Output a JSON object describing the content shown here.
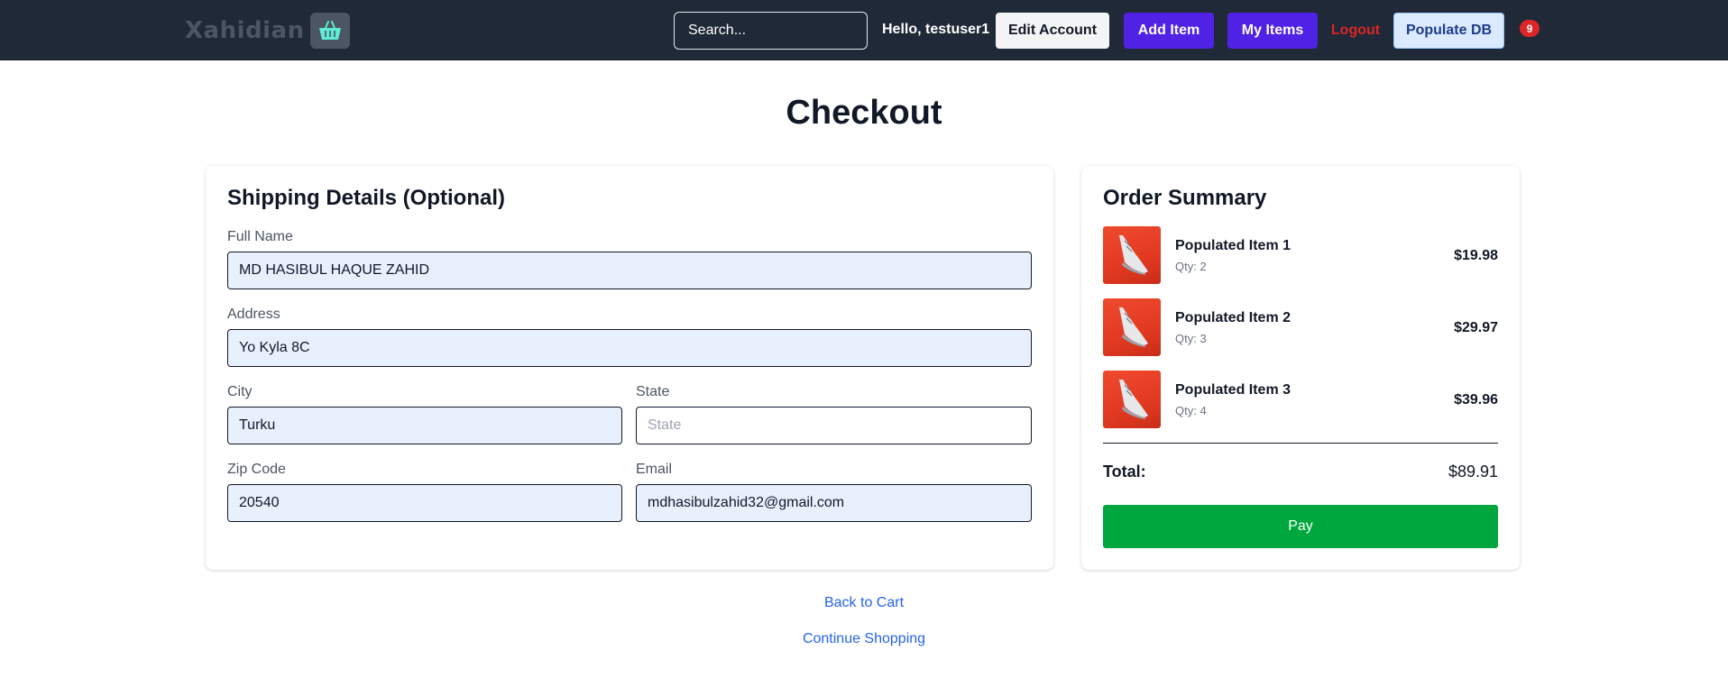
{
  "navbar": {
    "logo_text": "Xahidian",
    "logo_icon": "basket-icon",
    "search_placeholder": "Search...",
    "greeting": "Hello, testuser1",
    "edit_account_label": "Edit Account",
    "add_item_label": "Add Item",
    "my_items_label": "My Items",
    "logout_label": "Logout",
    "populate_db_label": "Populate DB",
    "cart_count": "9"
  },
  "page": {
    "title": "Checkout"
  },
  "shipping": {
    "heading": "Shipping Details (Optional)",
    "full_name": {
      "label": "Full Name",
      "value": "MD HASIBUL HAQUE ZAHID"
    },
    "address": {
      "label": "Address",
      "value": "Yo Kyla 8C"
    },
    "city": {
      "label": "City",
      "value": "Turku"
    },
    "state": {
      "label": "State",
      "value": "",
      "placeholder": "State"
    },
    "zip": {
      "label": "Zip Code",
      "value": "20540"
    },
    "email": {
      "label": "Email",
      "value": "mdhasibulzahid32@gmail.com"
    }
  },
  "summary": {
    "heading": "Order Summary",
    "items": [
      {
        "name": "Populated Item 1",
        "qty": "Qty: 2",
        "price": "$19.98",
        "image_icon": "sneaker-image"
      },
      {
        "name": "Populated Item 2",
        "qty": "Qty: 3",
        "price": "$29.97",
        "image_icon": "sneaker-image"
      },
      {
        "name": "Populated Item 3",
        "qty": "Qty: 4",
        "price": "$39.96",
        "image_icon": "sneaker-image"
      }
    ],
    "total_label": "Total:",
    "total_value": "$89.91",
    "pay_label": "Pay"
  },
  "links": {
    "back_to_cart": "Back to Cart",
    "continue_shopping": "Continue Shopping"
  },
  "colors": {
    "navbar_bg": "#1f2937",
    "primary_purple": "#4f22e6",
    "pay_green": "#00a63e",
    "logout_red": "#dc2626",
    "link_blue": "#2563eb",
    "autofill_bg": "#e8f0fe"
  }
}
